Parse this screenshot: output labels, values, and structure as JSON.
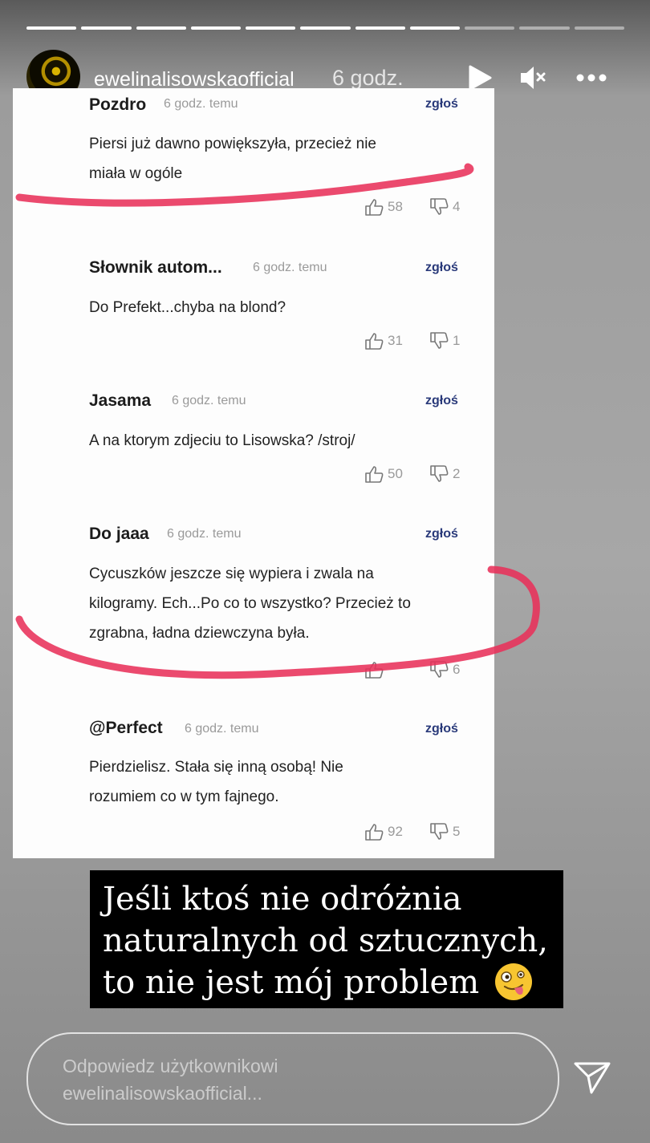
{
  "story": {
    "username": "ewelinalisowskaofficial",
    "time": "6 godz.",
    "progress_total": 11,
    "progress_done": 8
  },
  "comments": [
    {
      "author": "Pozdro",
      "time": "6 godz. temu",
      "report": "zgłoś",
      "text": "Piersi już dawno powiększyła, przecież nie\nmiała w ogóle",
      "likes": "58",
      "dislikes": "4"
    },
    {
      "author": "Słownik autom...",
      "time": "6 godz. temu",
      "report": "zgłoś",
      "text": "Do Prefekt...chyba na blond?",
      "likes": "31",
      "dislikes": "1"
    },
    {
      "author": "Jasama",
      "time": "6 godz. temu",
      "report": "zgłoś",
      "text": "A na ktorym zdjeciu to Lisowska? /stroj/",
      "likes": "50",
      "dislikes": "2"
    },
    {
      "author": "Do jaaa",
      "time": "6 godz. temu",
      "report": "zgłoś",
      "text": "Cycuszków jeszcze się wypiera i zwala na\nkilogramy. Ech...Po co to wszystko? Przecież to\nzgrabna, ładna dziewczyna była.",
      "likes": "",
      "dislikes": "6"
    },
    {
      "author": "@Perfect",
      "time": "6 godz. temu",
      "report": "zgłoś",
      "text": "Pierdzielisz. Stała się inną osobą! Nie\nrozumiem co w tym fajnego.",
      "likes": "92",
      "dislikes": "5"
    }
  ],
  "caption": "Jeśli ktoś nie odróżnia\nnaturalnych od sztucznych,\nto nie jest mój problem",
  "caption_emoji": "zany-face-emoji",
  "reply": {
    "placeholder": "Odpowiedz użytkownikowi\newelinalisowskaofficial..."
  },
  "colors": {
    "annotation": "#e8315a",
    "report_link": "#2a3a7a"
  }
}
